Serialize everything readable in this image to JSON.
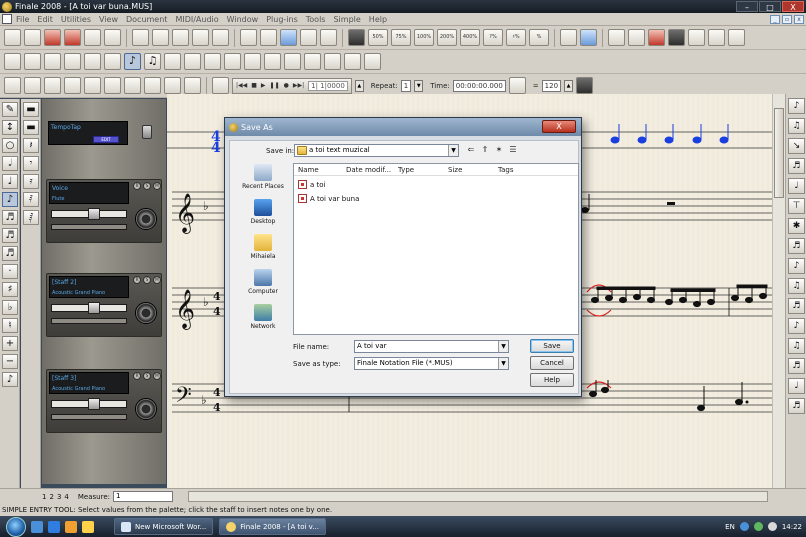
{
  "window": {
    "title": "Finale 2008 - [A toi var buna.MUS]",
    "controls": [
      "–",
      "□",
      "X"
    ],
    "mdi_controls": [
      "_",
      "▫",
      "x"
    ]
  },
  "menu": [
    "File",
    "Edit",
    "Utilities",
    "View",
    "Document",
    "MIDI/Audio",
    "Window",
    "Plug-ins",
    "Tools",
    "Simple",
    "Help"
  ],
  "toolbar_zoom": [
    "50%",
    "75%",
    "100%",
    "200%",
    "400%",
    "?%",
    "♯%",
    "%"
  ],
  "playback": {
    "counter": "1| 1|0000",
    "repeat_label": "Repeat:",
    "repeat_value": "1",
    "time_label": "Time:",
    "time_value": "00:00:00.000",
    "tempo_value": "120"
  },
  "mixer": {
    "tempo_label": "TempoTap",
    "edit_label": "EDIT",
    "tracks": [
      {
        "name": "Voice",
        "instrument": "Flute"
      },
      {
        "name": "[Staff 2]",
        "instrument": "Acoustic Grand Piano"
      },
      {
        "name": "[Staff 3]",
        "instrument": "Acoustic Grand Piano"
      }
    ],
    "rsm": [
      "R",
      "S",
      "M"
    ]
  },
  "dialog": {
    "title": "Save As",
    "close": "X",
    "save_in_label": "Save in:",
    "save_in_value": "a toi text muzical",
    "places": [
      "Recent Places",
      "Desktop",
      "Mihaiela",
      "Computer",
      "Network"
    ],
    "columns": [
      "Name",
      "Date modif...",
      "Type",
      "Size",
      "Tags"
    ],
    "files": [
      "a toi",
      "A toi var buna"
    ],
    "file_name_label": "File name:",
    "file_name_value": "A toi var",
    "save_type_label": "Save as type:",
    "save_type_value": "Finale Notation File (*.MUS)",
    "buttons": {
      "save": "Save",
      "cancel": "Cancel",
      "help": "Help"
    }
  },
  "measurebar": {
    "pages": [
      "1",
      "2",
      "3",
      "4"
    ],
    "measure_label": "Measure:",
    "measure_value": "1"
  },
  "status": "SIMPLE ENTRY TOOL: Select values from the palette; click the staff to insert notes one by one.",
  "taskbar": {
    "tasks": [
      "New Microsoft Wor...",
      "Finale 2008 - [A toi v..."
    ],
    "lang": "EN",
    "clock": "14:22"
  },
  "score": {
    "time_signature": [
      "4",
      "4"
    ]
  }
}
